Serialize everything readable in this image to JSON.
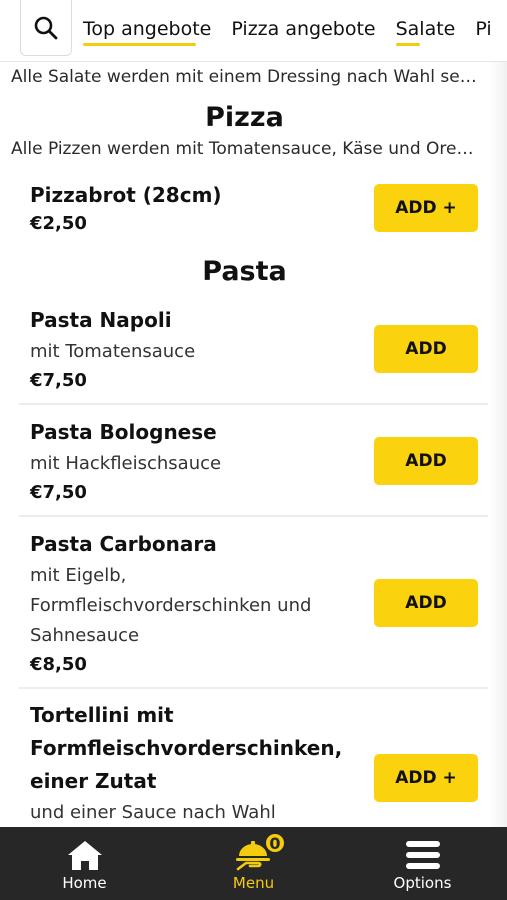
{
  "tabs": [
    {
      "label": "Top angebote",
      "underlined": true
    },
    {
      "label": "Pizza angebote",
      "underlined": false
    },
    {
      "label": "Salate",
      "underlined": true
    },
    {
      "label": "Pi",
      "underlined": false
    }
  ],
  "salad_note": "Alle Salate werden mit einem Dressing nach Wahl serviert",
  "pizza": {
    "title": "Pizza",
    "note": "Alle Pizzen werden mit Tomatensauce, Käse und Oregano belegt",
    "items": [
      {
        "name": "Pizzabrot (28cm)",
        "price": "€2,50",
        "button": "ADD +"
      }
    ]
  },
  "pasta": {
    "title": "Pasta",
    "items": [
      {
        "name": "Pasta Napoli",
        "desc": "mit Tomatensauce",
        "price": "€7,50",
        "button": "ADD"
      },
      {
        "name": "Pasta Bolognese",
        "desc": "mit Hackfleischsauce",
        "price": "€7,50",
        "button": "ADD"
      },
      {
        "name": "Pasta Carbonara",
        "desc_lines": [
          "mit Eigelb,",
          "Formfleischvorderschinken und",
          "Sahnesauce"
        ],
        "price": "€8,50",
        "button": "ADD"
      },
      {
        "name_lines": [
          "Tortellini mit",
          "Formfleischvorderschinken,",
          "einer Zutat"
        ],
        "desc": "und einer Sauce nach Wahl",
        "button": "ADD +"
      }
    ]
  },
  "nav": {
    "home": "Home",
    "menu": "Menu",
    "menu_badge": "0",
    "options": "Options"
  },
  "colors": {
    "accent": "#f4cc0e",
    "button": "#fbd20e",
    "nav_bg": "#272727"
  },
  "icons": {
    "search": "search-icon",
    "home": "home-icon",
    "menu": "food-tray-icon",
    "options": "hamburger-menu-icon"
  }
}
